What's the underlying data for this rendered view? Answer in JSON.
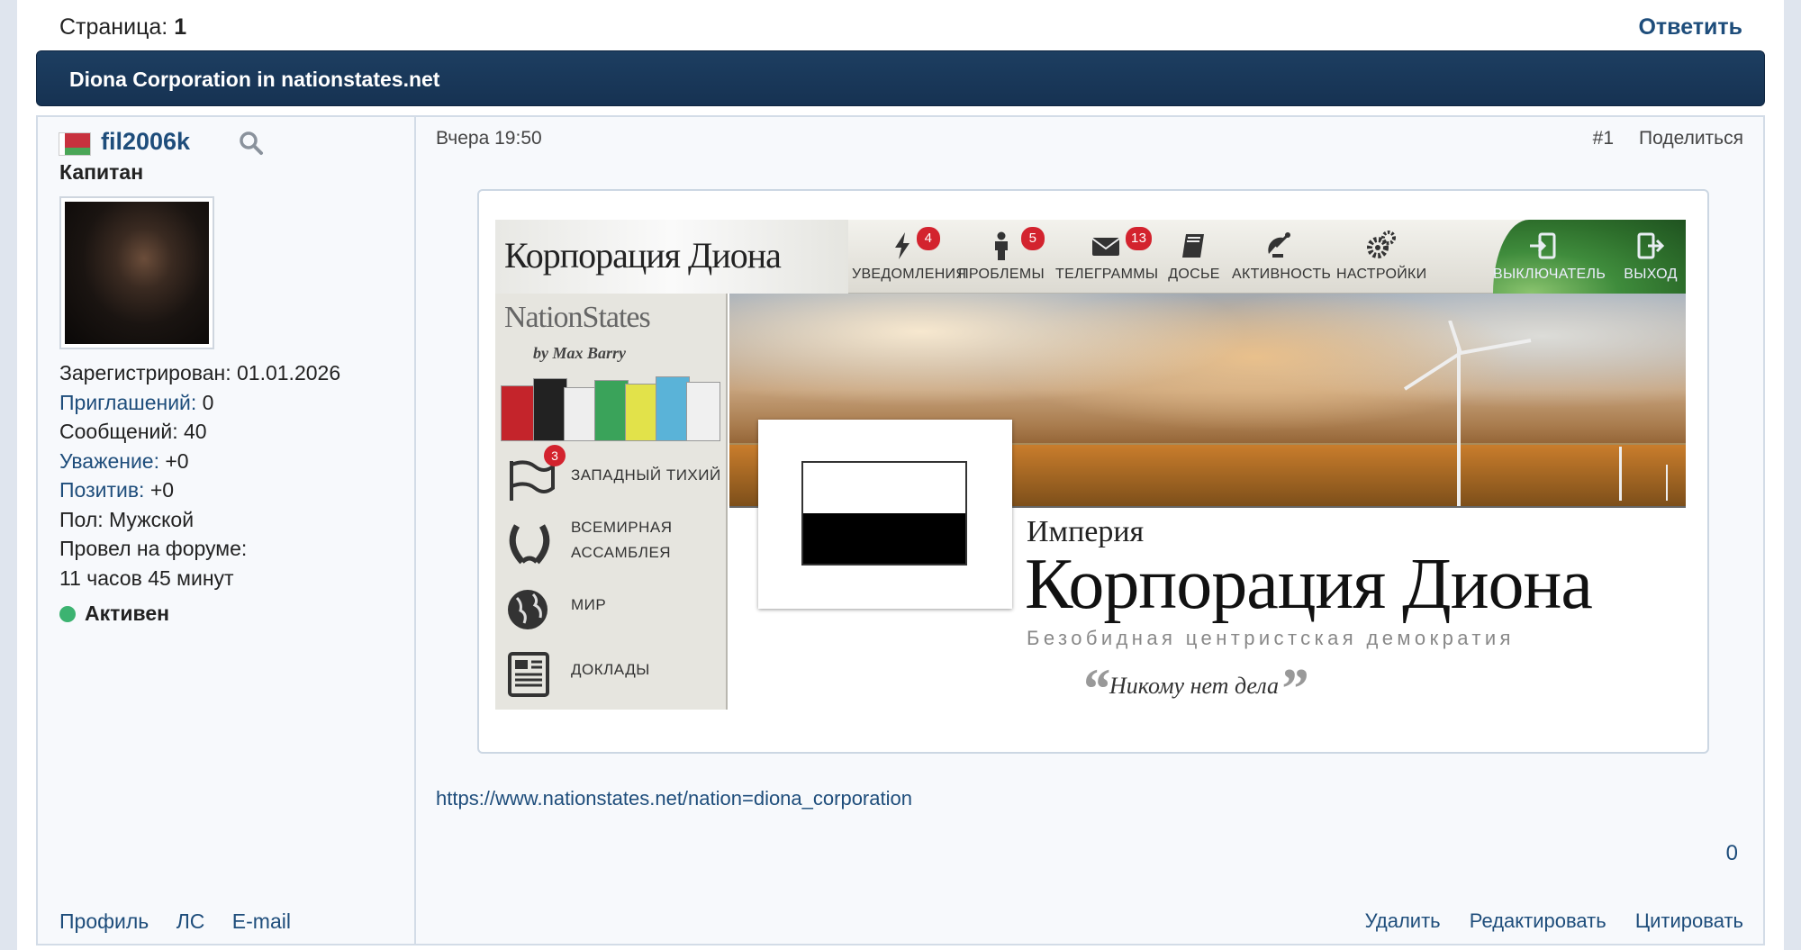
{
  "pagination": {
    "label": "Страница:",
    "current": "1",
    "reply": "Ответить"
  },
  "topic": {
    "title": "Diona Corporation in nationstates.net"
  },
  "author": {
    "name": "fil2006k",
    "rank": "Капитан",
    "registered": "Зарегистрирован: 01.01.2026",
    "invites_label": "Приглашений:",
    "invites_value": " 0",
    "messages": "Сообщений: 40",
    "respect_label": "Уважение:",
    "respect_value": " +0",
    "positive_label": "Позитив:",
    "positive_value": " +0",
    "gender": "Пол: Мужской",
    "time_label": "Провел на форуме:",
    "time_value": "11 часов 45 минут",
    "status": "Активен",
    "links": {
      "profile": "Профиль",
      "pm": "ЛС",
      "email": "E-mail"
    }
  },
  "post": {
    "date": "Вчера 19:50",
    "number": "#1",
    "share": "Поделиться",
    "url": "https://www.nationstates.net/nation=diona_corporation",
    "likes": "0",
    "actions": {
      "delete": "Удалить",
      "edit": "Редактировать",
      "quote": "Цитировать"
    }
  },
  "nationstates": {
    "header_title": "Корпорация Диона",
    "nav": [
      {
        "label": "УВЕДОМЛЕНИЯ",
        "badge": "4",
        "icon": "lightning-icon"
      },
      {
        "label": "ПРОБЛЕМЫ",
        "badge": "5",
        "icon": "person-icon"
      },
      {
        "label": "ТЕЛЕГРАММЫ",
        "badge": "13",
        "icon": "envelope-icon"
      },
      {
        "label": "ДОСЬЕ",
        "badge": "",
        "icon": "book-icon"
      },
      {
        "label": "АКТИВНОСТЬ",
        "badge": "",
        "icon": "satellite-icon"
      },
      {
        "label": "НАСТРОЙКИ",
        "badge": "",
        "icon": "gears-icon"
      },
      {
        "label": "ВЫКЛЮЧАТЕЛЬ",
        "badge": "",
        "icon": "switch-icon"
      },
      {
        "label": "ВЫХОД",
        "badge": "",
        "icon": "logout-icon"
      }
    ],
    "logo": "NationStates",
    "byline": "by Max Barry",
    "side": [
      {
        "label": "ЗАПАДНЫЙ ТИХИЙ",
        "badge": "3",
        "icon": "flag-icon"
      },
      {
        "label": "ВСЕМИРНАЯ",
        "label2": "АССАМБЛЕЯ",
        "icon": "laurel-icon"
      },
      {
        "label": "МИР",
        "icon": "globe-icon"
      },
      {
        "label": "ДОКЛАДЫ",
        "icon": "report-icon"
      }
    ],
    "pretitle": "Империя",
    "nation_name": "Корпорация Диона",
    "category": "Безобидная центристская демократия",
    "motto": "Никому нет дела",
    "colors": {
      "badge": "#d3232e",
      "header_bg": "#1d3e61",
      "link": "#1e4d7b",
      "status": "#3cb371"
    }
  }
}
